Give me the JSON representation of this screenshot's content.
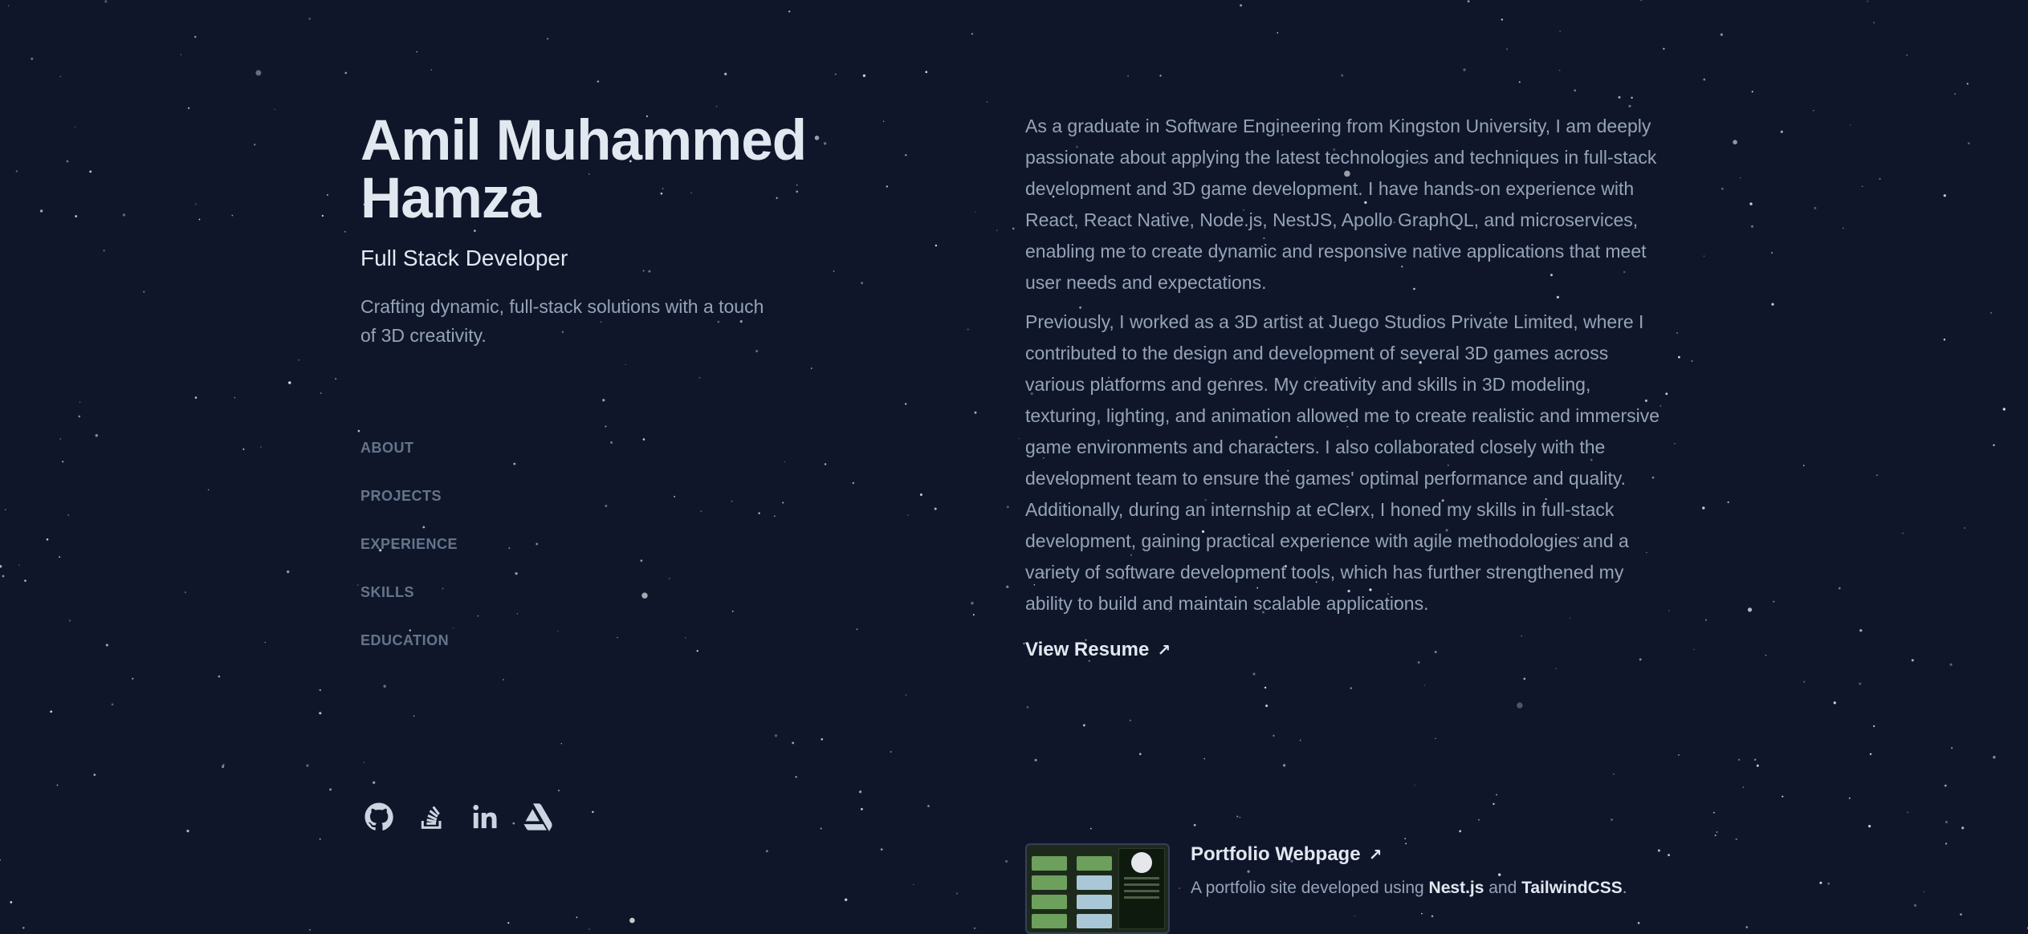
{
  "header": {
    "name": "Amil Muhammed Hamza",
    "role": "Full Stack Developer",
    "tagline": "Crafting dynamic, full-stack solutions with a touch of 3D creativity."
  },
  "nav": {
    "items": [
      {
        "label": "ABOUT"
      },
      {
        "label": "PROJECTS"
      },
      {
        "label": "EXPERIENCE"
      },
      {
        "label": "SKILLS"
      },
      {
        "label": "EDUCATION"
      }
    ]
  },
  "social": {
    "icons": [
      "github-icon",
      "stackoverflow-icon",
      "linkedin-icon",
      "artstation-icon"
    ]
  },
  "about": {
    "paragraphs": [
      "As a graduate in Software Engineering from Kingston University, I am deeply passionate about applying the latest technologies and techniques in full-stack development and 3D game development. I have hands-on experience with React, React Native, Node.js, NestJS, Apollo GraphQL, and microservices, enabling me to create dynamic and responsive native applications that meet user needs and expectations.",
      "Previously, I worked as a 3D artist at Juego Studios Private Limited, where I contributed to the design and development of several 3D games across various platforms and genres. My creativity and skills in 3D modeling, texturing, lighting, and animation allowed me to create realistic and immersive game environments and characters. I also collaborated closely with the development team to ensure the games' optimal performance and quality. Additionally, during an internship at eClerx, I honed my skills in full-stack development, gaining practical experience with agile methodologies and a variety of software development tools, which has further strengthened my ability to build and maintain scalable applications."
    ],
    "resume_label": "View Resume",
    "arrow": "↗"
  },
  "project": {
    "title": "Portfolio Webpage",
    "arrow": "↗",
    "desc_prefix": "A portfolio site developed using ",
    "tech1": "Nest.js",
    "desc_mid": " and ",
    "tech2": "TailwindCSS",
    "desc_suffix": "."
  },
  "colors": {
    "background": "#10162a",
    "heading": "#e2e8f0",
    "body_text": "#94a3b8",
    "nav_text": "#64748b"
  }
}
